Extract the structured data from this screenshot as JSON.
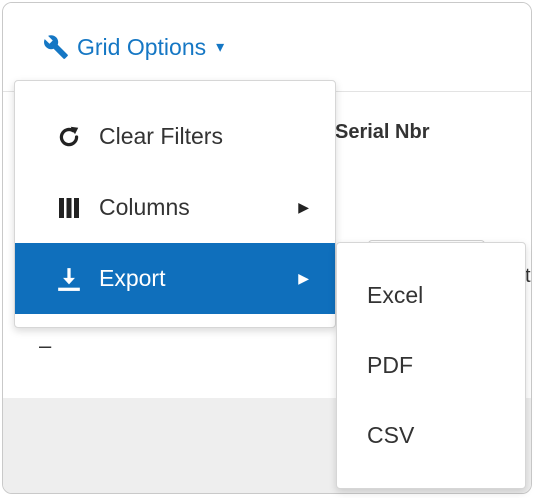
{
  "toolbar": {
    "grid_options_label": "Grid Options",
    "grid_options_icon": "wrench-icon",
    "caret": "▾"
  },
  "grid": {
    "columns": [
      "Serial Nbr"
    ],
    "row_value": "–",
    "clipped_text": "te"
  },
  "menu": {
    "items": [
      {
        "label": "Clear Filters",
        "icon": "refresh-icon"
      },
      {
        "label": "Columns",
        "icon": "columns-icon",
        "arrow": "▶"
      },
      {
        "label": "Export",
        "icon": "download-icon",
        "arrow": "▶",
        "active": true
      }
    ]
  },
  "export_submenu": {
    "items": [
      "Excel",
      "PDF",
      "CSV"
    ]
  },
  "colors": {
    "accent": "#1577c4",
    "active_bg": "#0f6fbc",
    "footer_bg": "#eeeeee"
  }
}
